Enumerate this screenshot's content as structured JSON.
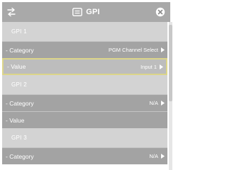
{
  "header": {
    "title": "GPI",
    "left_icon": "swap-arrows-icon",
    "title_icon": "gpi-panel-icon",
    "close_icon": "close-circle-icon"
  },
  "sections": [
    {
      "title": "GPI 1",
      "rows": [
        {
          "label": "- Category",
          "value": "PGM Channel Select",
          "selected": false
        },
        {
          "label": "- Value",
          "value": "Input 1",
          "selected": true
        }
      ]
    },
    {
      "title": "GPI 2",
      "rows": [
        {
          "label": "- Category",
          "value": "N/A",
          "selected": false
        },
        {
          "label": "- Value",
          "value": "",
          "selected": false
        }
      ]
    },
    {
      "title": "GPI 3",
      "rows": [
        {
          "label": "- Category",
          "value": "N/A",
          "selected": false
        }
      ]
    }
  ],
  "colors": {
    "header_bg": "#a9a9a9",
    "section_bg": "#d3d3d3",
    "row_bg": "#a3a3a3",
    "selected_border": "#dcd58a"
  }
}
